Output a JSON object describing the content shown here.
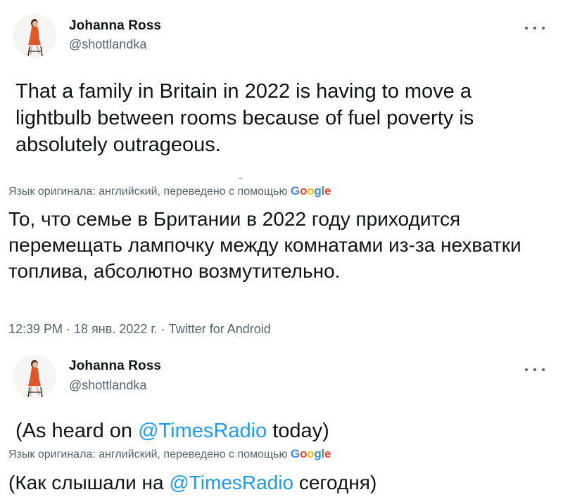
{
  "tweet1": {
    "author_name": "Johanna Ross",
    "author_handle": "@shottlandka",
    "text": "That a family in Britain in 2022 is having to move a lightbulb between rooms because of fuel poverty is absolutely outrageous.",
    "translation_note": "Язык оригинала: английский, переведено с помощью",
    "translation_provider": "Google",
    "translated_text": "То, что семье в Британии в 2022 году приходится перемещать лампочку между комнатами из-за нехватки топлива, абсолютно возмутительно.",
    "timestamp": "12:39 PM · 18 янв. 2022 г. · Twitter for Android"
  },
  "tweet2": {
    "author_name": "Johanna Ross",
    "author_handle": "@shottlandka",
    "text_before": "(As heard on ",
    "mention": "@TimesRadio",
    "text_after": " today)",
    "translation_note": "Язык оригинала: английский, переведено с помощью",
    "translation_provider": "Google",
    "translated_before": "(Как слышали на ",
    "translated_mention": "@TimesRadio",
    "translated_after": " сегодня)"
  },
  "colors": {
    "text": "#0f1419",
    "secondary": "#536471",
    "link": "#1d9bf0",
    "avatar_dress": "#e0582a",
    "avatar_hair": "#4a3024"
  },
  "icons": {
    "avatar": "avatar-woman-on-stool",
    "more": "more-horizontal-icon",
    "google_logo": "google-logo"
  }
}
